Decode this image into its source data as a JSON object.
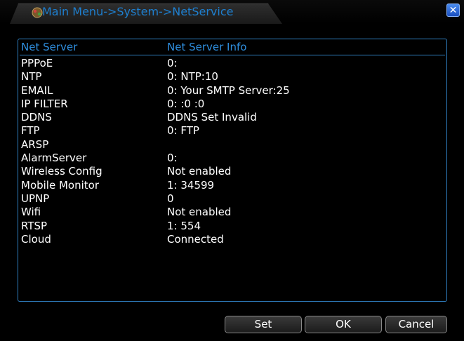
{
  "window": {
    "title": "Main Menu->System->NetService",
    "close_icon": "close-icon",
    "title_icon": "network-icon"
  },
  "table": {
    "headers": {
      "server": "Net Server",
      "info": "Net Server Info"
    },
    "rows": [
      {
        "server": "PPPoE",
        "info": "0:"
      },
      {
        "server": "NTP",
        "info": "0: NTP:10"
      },
      {
        "server": "EMAIL",
        "info": "0: Your SMTP Server:25"
      },
      {
        "server": "IP FILTER",
        "info": "0: :0 :0"
      },
      {
        "server": "DDNS",
        "info": "DDNS Set Invalid"
      },
      {
        "server": "FTP",
        "info": "0: FTP"
      },
      {
        "server": "ARSP",
        "info": ""
      },
      {
        "server": "AlarmServer",
        "info": "0:"
      },
      {
        "server": "Wireless Config",
        "info": "Not enabled"
      },
      {
        "server": "Mobile Monitor",
        "info": "1: 34599"
      },
      {
        "server": "UPNP",
        "info": "0"
      },
      {
        "server": "Wifi",
        "info": "Not enabled"
      },
      {
        "server": "RTSP",
        "info": "1: 554"
      },
      {
        "server": "Cloud",
        "info": "Connected"
      }
    ]
  },
  "buttons": {
    "set": "Set",
    "ok": "OK",
    "cancel": "Cancel"
  },
  "colors": {
    "accent": "#2f7fc0",
    "title": "#1e7fcf",
    "background": "#000000"
  }
}
